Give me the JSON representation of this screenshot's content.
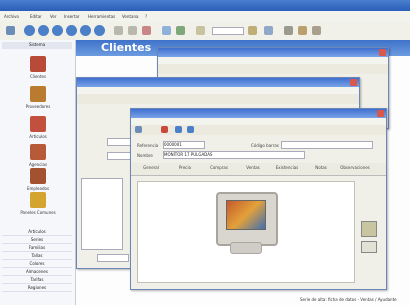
{
  "app": {
    "menu": [
      "Archivo",
      "Editar",
      "Ver",
      "Insertar",
      "Herramientas",
      "Ventana",
      "?"
    ],
    "section_title": "Clientes"
  },
  "sidebar": {
    "header": "Sistema",
    "items": [
      {
        "label": "Clientes",
        "icon": "clients-icon"
      },
      {
        "label": "Proveedores",
        "icon": "suppliers-icon"
      },
      {
        "label": "Artículos",
        "icon": "articles-icon"
      },
      {
        "label": "Agencias",
        "icon": "agencies-icon"
      },
      {
        "label": "Empleados",
        "icon": "employees-icon"
      },
      {
        "label": "Paneles Comunes",
        "icon": "common-panels-icon"
      }
    ],
    "list": [
      "Artículos",
      "Series",
      "Familias",
      "Tallas",
      "Colores",
      "Almacenes",
      "Tarifas",
      "Regiones"
    ]
  },
  "form": {
    "fields": [
      {
        "label": "Referencia",
        "value": "0000001"
      },
      {
        "label": "Nombre",
        "value": "MONITOR 17 PULGADAS"
      }
    ],
    "code_label": "Código barras",
    "tabs": [
      "General",
      "Precio",
      "Compras",
      "Ventas",
      "Existencias",
      "Notas",
      "Observaciones"
    ]
  },
  "status": {
    "text": "Serie de alta: ficha de datos - Ventas / Ayudante"
  }
}
